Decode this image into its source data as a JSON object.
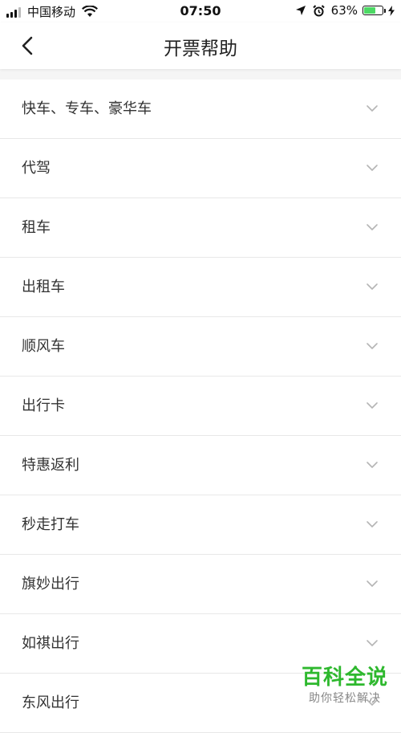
{
  "status_bar": {
    "carrier": "中国移动",
    "time": "07:50",
    "battery": "63%",
    "battery_level": 0.63,
    "icons": [
      "signal-icon",
      "wifi-icon",
      "location-arrow-icon",
      "alarm-icon",
      "battery-icon",
      "charging-bolt-icon"
    ]
  },
  "nav": {
    "title": "开票帮助",
    "back_icon": "chevron-left-icon"
  },
  "list": {
    "items": [
      {
        "label": "快车、专车、豪华车"
      },
      {
        "label": "代驾"
      },
      {
        "label": "租车"
      },
      {
        "label": "出租车"
      },
      {
        "label": "顺风车"
      },
      {
        "label": "出行卡"
      },
      {
        "label": "特惠返利"
      },
      {
        "label": "秒走打车"
      },
      {
        "label": "旗妙出行"
      },
      {
        "label": "如祺出行"
      },
      {
        "label": "东风出行"
      }
    ],
    "chevron_icon": "chevron-down-icon"
  },
  "watermark": {
    "title": "百科全说",
    "subtitle": "助你轻松解决"
  },
  "colors": {
    "background": "#f5f5f5",
    "battery_green": "#4cd964",
    "watermark_green": "#2eb82e",
    "chevron": "#b5b5b5"
  }
}
